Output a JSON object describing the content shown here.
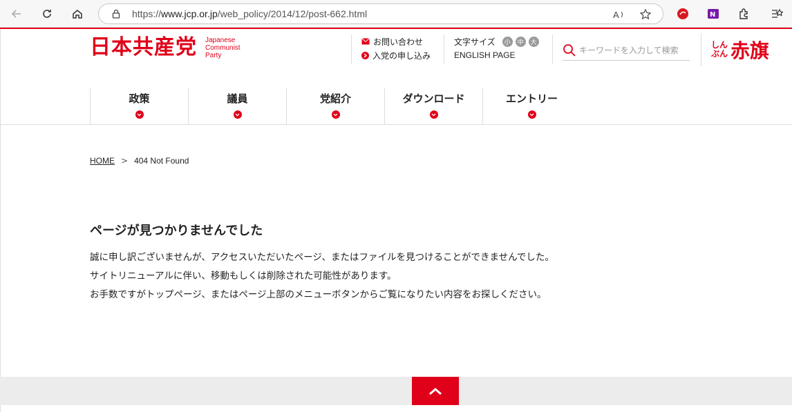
{
  "browser": {
    "url_prefix": "https://",
    "url_host": "www.jcp.or.jp",
    "url_path": "/web_policy/2014/12/post-662.html"
  },
  "site": {
    "logo_main": "日本共産党",
    "logo_sub_1": "Japanese",
    "logo_sub_2": "Communist",
    "logo_sub_3": "Party",
    "contact": "お問い合わせ",
    "join": "入党の申し込み",
    "font_size_label": "文字サイズ",
    "font_small": "小",
    "font_mid": "中",
    "font_large": "大",
    "english": "ENGLISH PAGE",
    "search_placeholder": "キーワードを入力して検索",
    "akahata_small_1": "しん",
    "akahata_small_2": "ぶん",
    "akahata_big": "赤旗",
    "brand_color": "#e00019"
  },
  "nav": {
    "items": [
      {
        "label": "政策"
      },
      {
        "label": "議員"
      },
      {
        "label": "党紹介"
      },
      {
        "label": "ダウンロード"
      },
      {
        "label": "エントリー"
      }
    ]
  },
  "breadcrumb": {
    "home": "HOME",
    "separator": ">",
    "current": "404 Not Found"
  },
  "content": {
    "heading": "ページが見つかりませんでした",
    "line1": "誠に申し訳ございませんが、アクセスいただいたページ、またはファイルを見つけることができませんでした。",
    "line2": "サイトリニューアルに伴い、移動もしくは削除された可能性があります。",
    "line3": "お手数ですがトップページ、またはページ上部のメニューボタンからご覧になりたい内容をお探しください。"
  }
}
